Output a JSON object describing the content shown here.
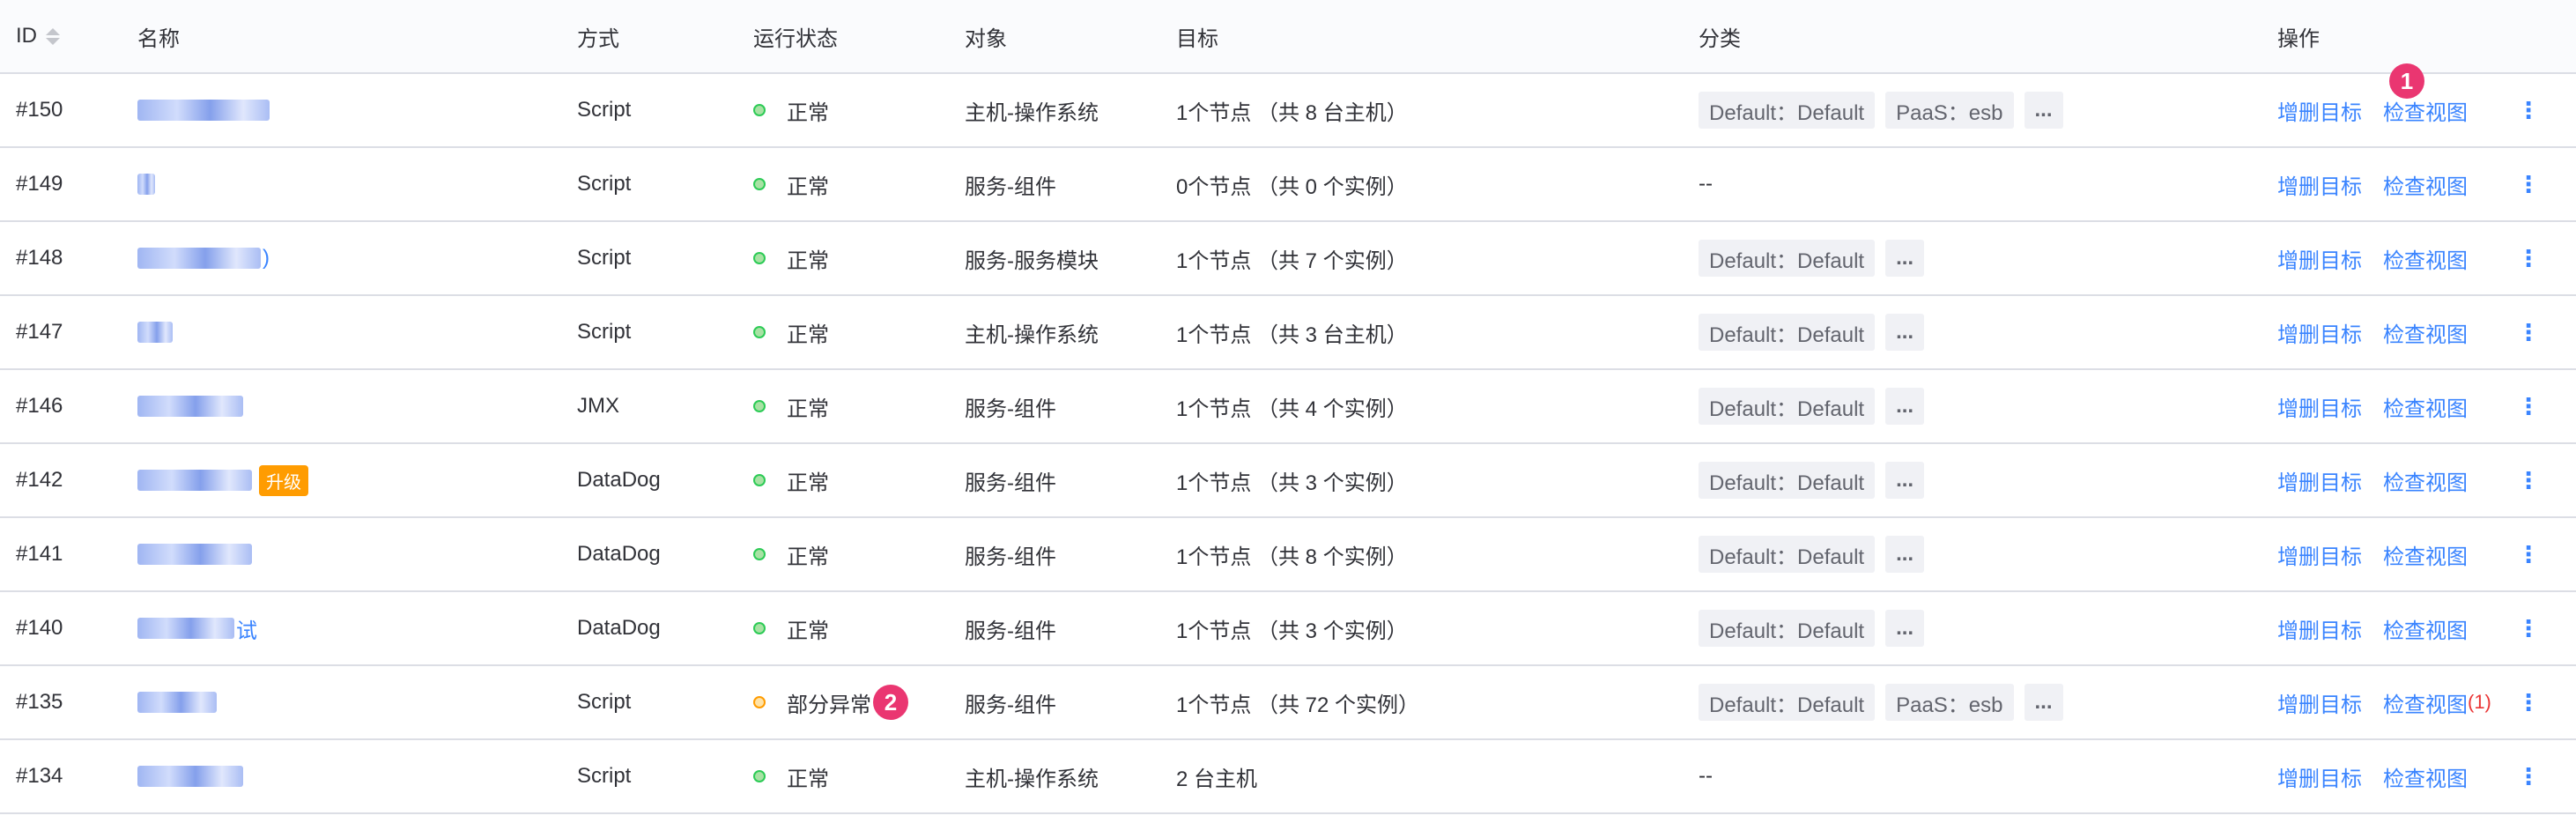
{
  "header": {
    "id": "ID",
    "name": "名称",
    "method": "方式",
    "status": "运行状态",
    "object": "对象",
    "target": "目标",
    "category": "分类",
    "ops": "操作"
  },
  "badges": {
    "ops_marker": "1",
    "status_marker": "2"
  },
  "actions": {
    "edit_target": "增删目标",
    "view": "检查视图",
    "more_glyph": "⋮"
  },
  "empty_category": "--",
  "rows": [
    {
      "id": "#150",
      "name_suffix": "",
      "upgrade": "",
      "method": "Script",
      "status": "正常",
      "status_type": "ok",
      "object": "主机-操作系统",
      "target": "1个节点 （共 8 台主机）",
      "categories": [
        "Default：Default",
        "PaaS：esb",
        "..."
      ],
      "view_error": ""
    },
    {
      "id": "#149",
      "name_suffix": "",
      "upgrade": "",
      "method": "Script",
      "status": "正常",
      "status_type": "ok",
      "object": "服务-组件",
      "target": "0个节点 （共 0 个实例）",
      "categories": [],
      "view_error": ""
    },
    {
      "id": "#148",
      "name_suffix": ")",
      "upgrade": "",
      "method": "Script",
      "status": "正常",
      "status_type": "ok",
      "object": "服务-服务模块",
      "target": "1个节点 （共 7 个实例）",
      "categories": [
        "Default：Default",
        "..."
      ],
      "view_error": ""
    },
    {
      "id": "#147",
      "name_suffix": "",
      "upgrade": "",
      "method": "Script",
      "status": "正常",
      "status_type": "ok",
      "object": "主机-操作系统",
      "target": "1个节点 （共 3 台主机）",
      "categories": [
        "Default：Default",
        "..."
      ],
      "view_error": ""
    },
    {
      "id": "#146",
      "name_suffix": "",
      "upgrade": "",
      "method": "JMX",
      "status": "正常",
      "status_type": "ok",
      "object": "服务-组件",
      "target": "1个节点 （共 4 个实例）",
      "categories": [
        "Default：Default",
        "..."
      ],
      "view_error": ""
    },
    {
      "id": "#142",
      "name_suffix": "",
      "upgrade": "升级",
      "method": "DataDog",
      "status": "正常",
      "status_type": "ok",
      "object": "服务-组件",
      "target": "1个节点 （共 3 个实例）",
      "categories": [
        "Default：Default",
        "..."
      ],
      "view_error": ""
    },
    {
      "id": "#141",
      "name_suffix": "",
      "upgrade": "",
      "method": "DataDog",
      "status": "正常",
      "status_type": "ok",
      "object": "服务-组件",
      "target": "1个节点 （共 8 个实例）",
      "categories": [
        "Default：Default",
        "..."
      ],
      "view_error": ""
    },
    {
      "id": "#140",
      "name_suffix": "试",
      "upgrade": "",
      "method": "DataDog",
      "status": "正常",
      "status_type": "ok",
      "object": "服务-组件",
      "target": "1个节点 （共 3 个实例）",
      "categories": [
        "Default：Default",
        "..."
      ],
      "view_error": ""
    },
    {
      "id": "#135",
      "name_suffix": "",
      "upgrade": "",
      "method": "Script",
      "status": "部分异常",
      "status_type": "warn",
      "object": "服务-组件",
      "target": "1个节点 （共 72 个实例）",
      "categories": [
        "Default：Default",
        "PaaS：esb",
        "..."
      ],
      "view_error": "(1)"
    },
    {
      "id": "#134",
      "name_suffix": "",
      "upgrade": "",
      "method": "Script",
      "status": "正常",
      "status_type": "ok",
      "object": "主机-操作系统",
      "target": "2 台主机",
      "categories": [],
      "view_error": ""
    }
  ]
}
